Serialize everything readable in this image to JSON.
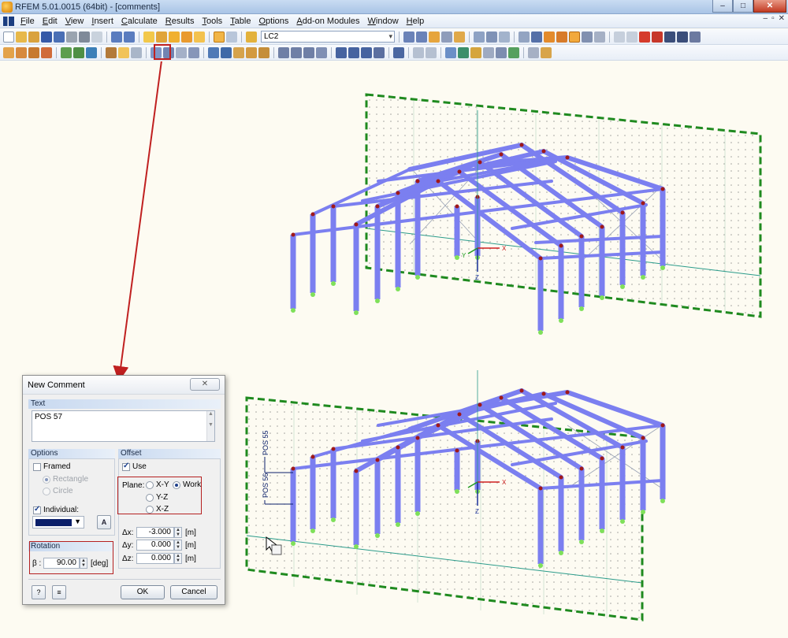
{
  "window": {
    "title": "RFEM 5.01.0015 (64bit) - [comments]",
    "minimize": "–",
    "maximize": "□",
    "close": "✕"
  },
  "menu": {
    "items": [
      "File",
      "Edit",
      "View",
      "Insert",
      "Calculate",
      "Results",
      "Tools",
      "Table",
      "Options",
      "Add-on Modules",
      "Window",
      "Help"
    ],
    "mdi_min": "–",
    "mdi_restore": "▫",
    "mdi_close": "✕"
  },
  "toolbar": {
    "loadcase_value": "LC2"
  },
  "scene": {
    "pos_label_1": "POS 55",
    "pos_label_2": "POS 56",
    "axis_x": "X",
    "axis_y": "Y",
    "axis_z": "Z"
  },
  "dialog": {
    "title": "New Comment",
    "close_label": "✕",
    "text_group": "Text",
    "text_value": "POS 57",
    "options_group": "Options",
    "framed_label": "Framed",
    "rectangle_label": "Rectangle",
    "circle_label": "Circle",
    "individual_label": "Individual:",
    "offset_group": "Offset",
    "use_label": "Use",
    "plane_label": "Plane:",
    "plane_xy": "X-Y",
    "plane_work": "Work",
    "plane_yz": "Y-Z",
    "plane_xz": "X-Z",
    "dx_label": "Δx:",
    "dx_value": "-3.000",
    "dy_label": "Δy:",
    "dy_value": "0.000",
    "dz_label": "Δz:",
    "dz_value": "0.000",
    "unit_m": "[m]",
    "rotation_group": "Rotation",
    "beta_label": "β :",
    "beta_value": "90.00",
    "unit_deg": "[deg]",
    "ok_label": "OK",
    "cancel_label": "Cancel"
  },
  "colors": {
    "member": "#7b7ff0",
    "workplane": "#1f8a1f",
    "comment": "#0a1f6a",
    "highlight": "#c02020"
  }
}
